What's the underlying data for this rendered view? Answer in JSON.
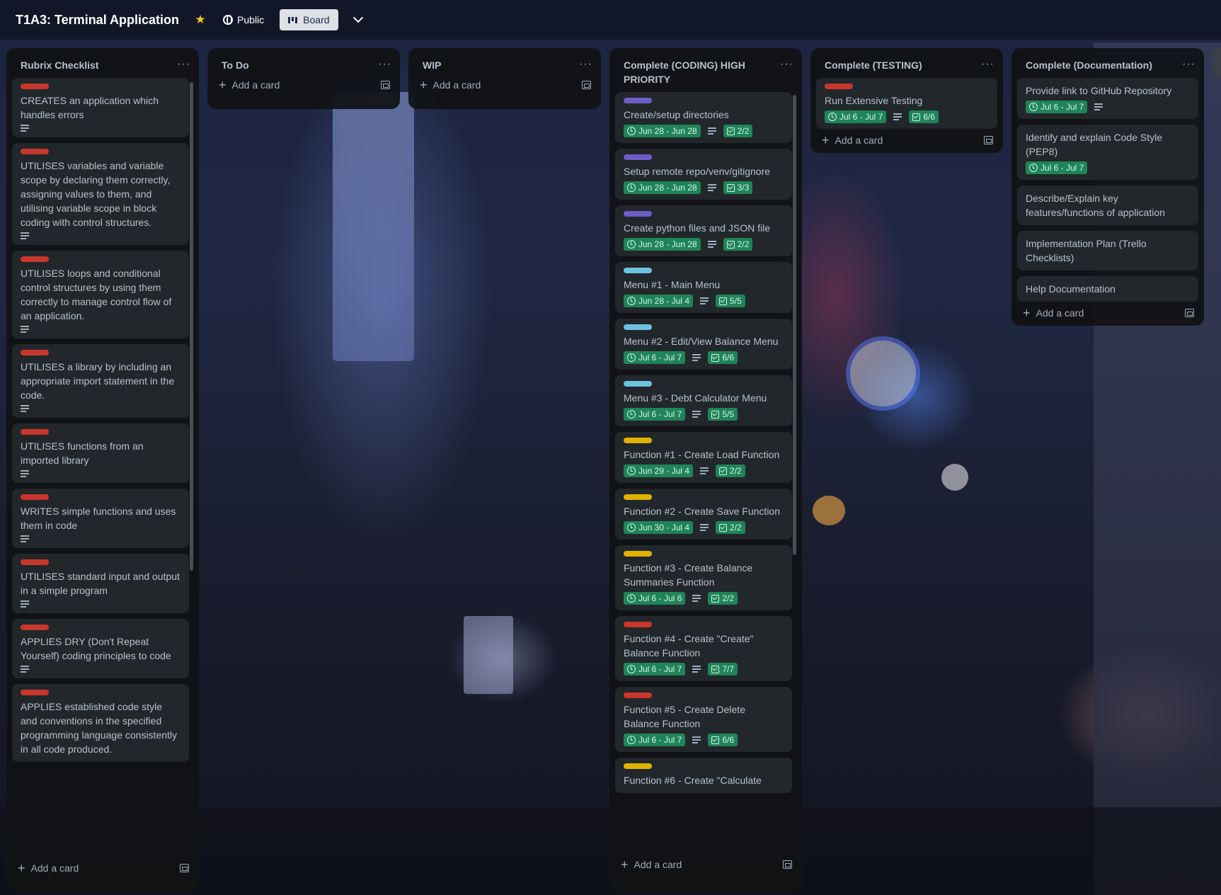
{
  "header": {
    "board_title": "T1A3: Terminal Application",
    "visibility": "Public",
    "view": "Board"
  },
  "colors": {
    "red_label": "#c9372c",
    "purple_label": "#6e5dc6",
    "sky_label": "#6cc3e0",
    "yellow_label": "#e2b203",
    "due_green": "#1f845a"
  },
  "add_card_label": "Add a card",
  "lists": [
    {
      "title": "Rubrix Checklist",
      "cards": [
        {
          "label": "red",
          "title": "CREATES an application which handles errors"
        },
        {
          "label": "red",
          "title": "UTILISES variables and variable scope by declaring them correctly, assigning values to them, and utilising variable scope in block coding with control structures."
        },
        {
          "label": "red",
          "title": "UTILISES loops and conditional control structures by using them correctly to manage control flow of an application."
        },
        {
          "label": "red",
          "title": "UTILISES a library by including an appropriate import statement in the code."
        },
        {
          "label": "red",
          "title": "UTILISES functions from an imported library"
        },
        {
          "label": "red",
          "title": "WRITES simple functions and uses them in code"
        },
        {
          "label": "red",
          "title": "UTILISES standard input and output in a simple program"
        },
        {
          "label": "red",
          "title": "APPLIES DRY (Don't Repeat Yourself) coding principles to code"
        },
        {
          "label": "red",
          "title": "APPLIES established code style and conventions in the specified programming language consistently in all code produced."
        }
      ]
    },
    {
      "title": "To Do",
      "cards": []
    },
    {
      "title": "WIP",
      "cards": []
    },
    {
      "title": "Complete (CODING) HIGH PRIORITY",
      "cards": [
        {
          "label": "purple",
          "title": "Create/setup directories",
          "date": "Jun 28 - Jun 28",
          "check": "2/2"
        },
        {
          "label": "purple",
          "title": "Setup remote repo/venv/gitignore",
          "date": "Jun 28 - Jun 28",
          "check": "3/3"
        },
        {
          "label": "purple",
          "title": "Create python files and JSON file",
          "date": "Jun 28 - Jun 28",
          "check": "2/2"
        },
        {
          "label": "sky",
          "title": "Menu #1 - Main Menu",
          "date": "Jun 28 - Jul 4",
          "check": "5/5"
        },
        {
          "label": "sky",
          "title": "Menu #2 - Edit/View Balance Menu",
          "date": "Jul 6 - Jul 7",
          "check": "6/6"
        },
        {
          "label": "sky",
          "title": "Menu #3 - Debt Calculator Menu",
          "date": "Jul 6 - Jul 7",
          "check": "5/5"
        },
        {
          "label": "yellow",
          "title": "Function #1 - Create Load Function",
          "date": "Jun 29 - Jul 4",
          "check": "2/2"
        },
        {
          "label": "yellow",
          "title": "Function #2 - Create Save Function",
          "date": "Jun 30 - Jul 4",
          "check": "2/2"
        },
        {
          "label": "yellow",
          "title": "Function #3 - Create Balance Summaries Function",
          "date": "Jul 6 - Jul 6",
          "check": "2/2"
        },
        {
          "label": "red",
          "title": "Function #4 - Create \"Create\" Balance Function",
          "date": "Jul 6 - Jul 7",
          "check": "7/7"
        },
        {
          "label": "red",
          "title": "Function #5 - Create Delete Balance Function",
          "date": "Jul 6 - Jul 7",
          "check": "6/6"
        },
        {
          "label": "yellow",
          "title": "Function #6 - Create \"Calculate"
        }
      ]
    },
    {
      "title": "Complete (TESTING)",
      "cards": [
        {
          "label": "red",
          "title": "Run Extensive Testing",
          "date": "Jul 6 - Jul 7",
          "check": "6/6"
        }
      ]
    },
    {
      "title": "Complete (Documentation)",
      "cards": [
        {
          "title": "Provide link to GitHub Repository",
          "date": "Jul 6 - Jul 7"
        },
        {
          "title": "Identify and explain Code Style (PEP8)",
          "date": "Jul 6 - Jul 7"
        },
        {
          "title": "Describe/Explain key features/functions of application"
        },
        {
          "title": "Implementation Plan (Trello Checklists)"
        },
        {
          "title": "Help Documentation"
        }
      ]
    }
  ]
}
